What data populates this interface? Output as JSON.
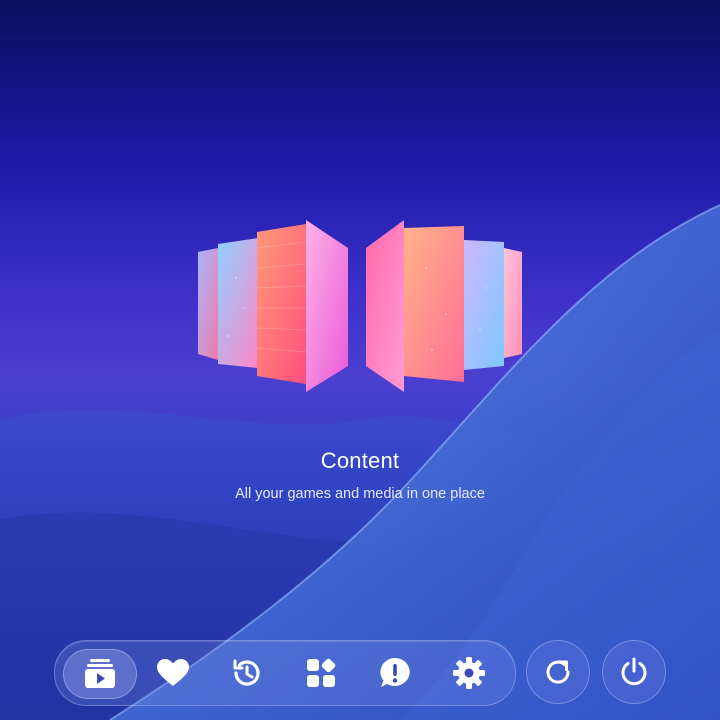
{
  "hero": {
    "title": "Content",
    "subtitle": "All your games and media in one place"
  },
  "dock": {
    "items": [
      {
        "icon": "media-library-icon",
        "active": true
      },
      {
        "icon": "heart-icon",
        "active": false
      },
      {
        "icon": "history-icon",
        "active": false
      },
      {
        "icon": "apps-icon",
        "active": false
      },
      {
        "icon": "feedback-icon",
        "active": false
      },
      {
        "icon": "gear-icon",
        "active": false
      }
    ]
  },
  "controls": {
    "restart": {
      "icon": "restart-icon"
    },
    "power": {
      "icon": "power-icon"
    }
  },
  "colors": {
    "accent": "#ffffff",
    "background_top": "#0b0f5c",
    "background_mid": "#4b3fd0",
    "background_bottom": "#1e2f9e"
  }
}
